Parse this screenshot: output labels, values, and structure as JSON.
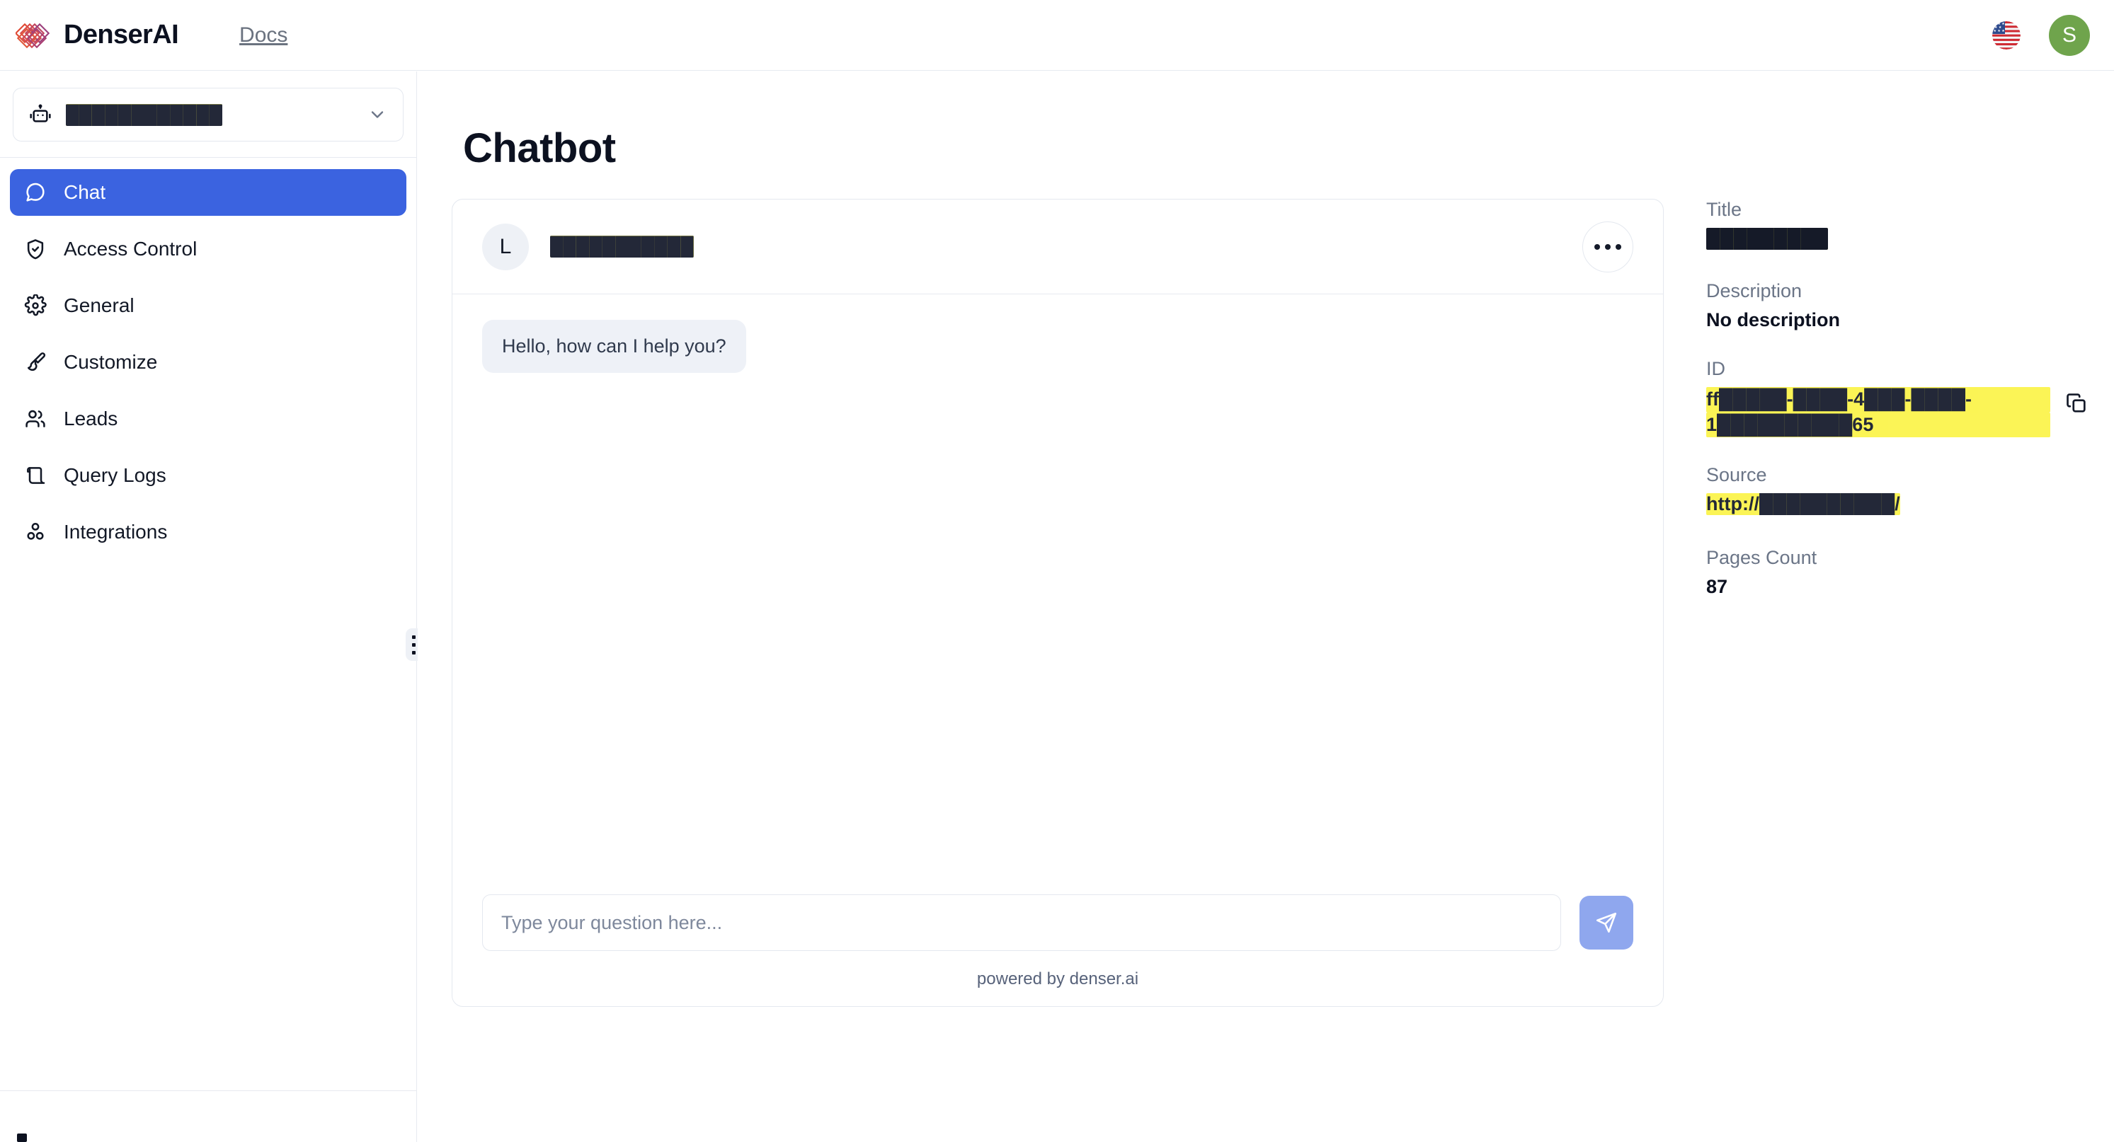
{
  "topbar": {
    "brand_name": "DenserAI",
    "logo_icon": "denser-diamond-logo",
    "nav_docs": "Docs",
    "language_icon": "us-flag-icon",
    "avatar_initial": "S",
    "avatar_color": "#6fa44c"
  },
  "sidebar": {
    "bot_selector": {
      "icon": "bot-icon",
      "name_redacted": "████████████",
      "chevron_icon": "chevron-down-icon"
    },
    "items": [
      {
        "label": "Chat",
        "icon": "message-circle-icon",
        "active": true
      },
      {
        "label": "Access Control",
        "icon": "shield-check-icon",
        "active": false
      },
      {
        "label": "General",
        "icon": "gear-icon",
        "active": false
      },
      {
        "label": "Customize",
        "icon": "paintbrush-icon",
        "active": false
      },
      {
        "label": "Leads",
        "icon": "users-icon",
        "active": false
      },
      {
        "label": "Query Logs",
        "icon": "scroll-icon",
        "active": false
      },
      {
        "label": "Integrations",
        "icon": "blocks-icon",
        "active": false
      }
    ],
    "active_color": "#3b63e0",
    "drag_handle_icon": "grip-dots-icon"
  },
  "main": {
    "page_title": "Chatbot",
    "chat": {
      "avatar_initial": "L",
      "bot_name_redacted": "███████████",
      "menu_icon": "kebab-menu-icon",
      "messages": [
        {
          "role": "assistant",
          "text": "Hello, how can I help you?"
        }
      ],
      "input_value": "",
      "input_placeholder": "Type your question here...",
      "send_icon": "send-paper-plane-icon",
      "send_button_color": "#8fa7ee",
      "footer": "powered by denser.ai"
    },
    "info": {
      "title_label": "Title",
      "title_value_redacted": "█████████",
      "description_label": "Description",
      "description_value": "No description",
      "id_label": "ID",
      "id_value_line1_redacted": "ff█████-████-4███-████-",
      "id_value_line2_redacted": "1██████████65",
      "copy_icon": "copy-icon",
      "source_label": "Source",
      "source_value": "http://██████████/",
      "pages_count_label": "Pages Count",
      "pages_count_value": "87"
    }
  }
}
